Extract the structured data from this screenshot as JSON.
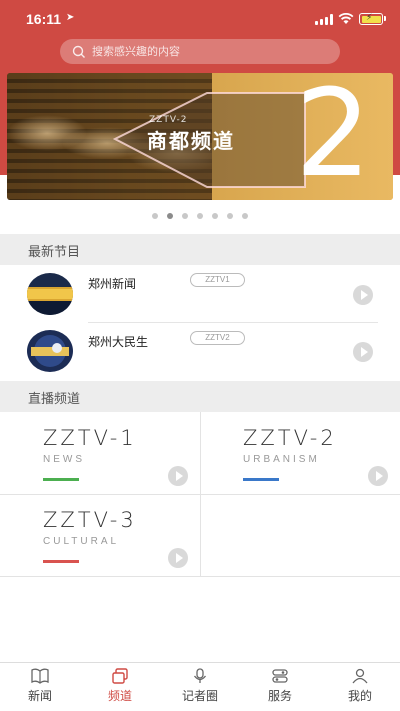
{
  "status": {
    "time": "16:11"
  },
  "search": {
    "placeholder": "搜索感兴趣的内容"
  },
  "banner": {
    "subtitle": "ZZTV-2",
    "title": "商都频道",
    "number": "2"
  },
  "carousel": {
    "count": 7,
    "active": 1
  },
  "latest": {
    "header": "最新节目",
    "items": [
      {
        "title": "郑州新闻",
        "tag": "ZZTV1"
      },
      {
        "title": "郑州大民生",
        "tag": "ZZTV2"
      }
    ]
  },
  "live": {
    "header": "直播频道",
    "channels": [
      {
        "name": "ZZTV-1",
        "en": "NEWS",
        "color": "#4caf50"
      },
      {
        "name": "ZZTV-2",
        "en": "URBANISM",
        "color": "#3a78c9"
      },
      {
        "name": "ZZTV-3",
        "en": "CULTURAL",
        "color": "#d9534f"
      }
    ]
  },
  "tabs": [
    {
      "label": "新闻",
      "icon": "book-icon",
      "active": false
    },
    {
      "label": "频道",
      "icon": "channels-icon",
      "active": true
    },
    {
      "label": "记者圈",
      "icon": "microphone-icon",
      "active": false
    },
    {
      "label": "服务",
      "icon": "service-icon",
      "active": false
    },
    {
      "label": "我的",
      "icon": "user-icon",
      "active": false
    }
  ],
  "colors": {
    "brand": "#cf4a43",
    "section_bg": "#ededed"
  }
}
